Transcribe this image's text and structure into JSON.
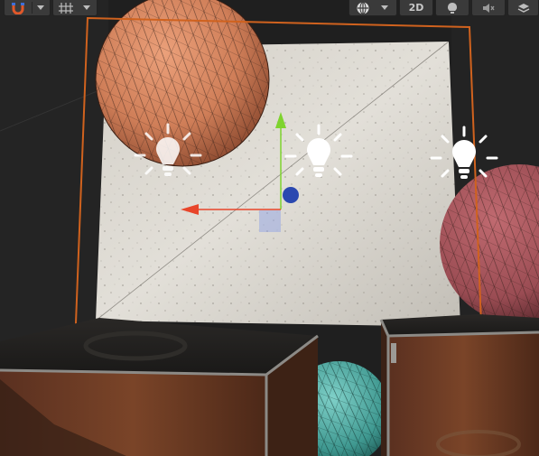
{
  "toolbar": {
    "left": [
      {
        "name": "magnet-snap-icon"
      },
      {
        "name": "grid-snap-icon"
      }
    ],
    "right": [
      {
        "name": "draw-mode-sphere-icon"
      },
      {
        "name": "toggle-2d-button",
        "label": "2D"
      },
      {
        "name": "lighting-toggle-icon"
      },
      {
        "name": "audio-mute-icon"
      },
      {
        "name": "effects-layers-icon"
      }
    ]
  },
  "scene": {
    "lights": [
      "point-light-gizmo-left",
      "point-light-gizmo-center",
      "point-light-gizmo-right"
    ],
    "colors": {
      "background": "#1f1f1f",
      "wall": "#d8d4cc",
      "selection_outline": "#d0621e",
      "gizmo_y": "#7ed32e",
      "gizmo_x": "#e8452a",
      "gizmo_center": "#2a48b0",
      "sphere_orange": "#d58a64",
      "sphere_red": "#a4565d",
      "sphere_teal": "#4fa9a2",
      "crate": "#6b3a24"
    }
  }
}
